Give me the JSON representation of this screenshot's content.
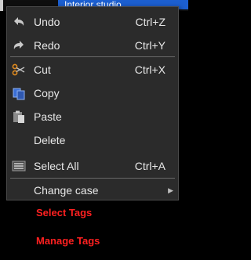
{
  "top": {
    "highlight_text": "Interior studio"
  },
  "menu": {
    "items": [
      {
        "label": "Undo",
        "shortcut": "Ctrl+Z",
        "icon": "undo-icon"
      },
      {
        "label": "Redo",
        "shortcut": "Ctrl+Y",
        "icon": "redo-icon"
      },
      {
        "label": "Cut",
        "shortcut": "Ctrl+X",
        "icon": "scissors-icon"
      },
      {
        "label": "Copy",
        "shortcut": "",
        "icon": "copy-icon"
      },
      {
        "label": "Paste",
        "shortcut": "",
        "icon": "paste-icon"
      },
      {
        "label": "Delete",
        "shortcut": "",
        "icon": ""
      },
      {
        "label": "Select All",
        "shortcut": "Ctrl+A",
        "icon": "select-all-icon"
      },
      {
        "label": "Change case",
        "shortcut": "",
        "icon": ""
      }
    ],
    "submenu_arrow": "▶"
  },
  "background_links": {
    "select_tags": "Select Tags",
    "manage_tags": "Manage Tags"
  },
  "colors": {
    "menu_bg": "#2b2b2b",
    "menu_text": "#e8e8e8",
    "accent_blue": "#1c5fd0",
    "link_red": "#ff2020"
  }
}
